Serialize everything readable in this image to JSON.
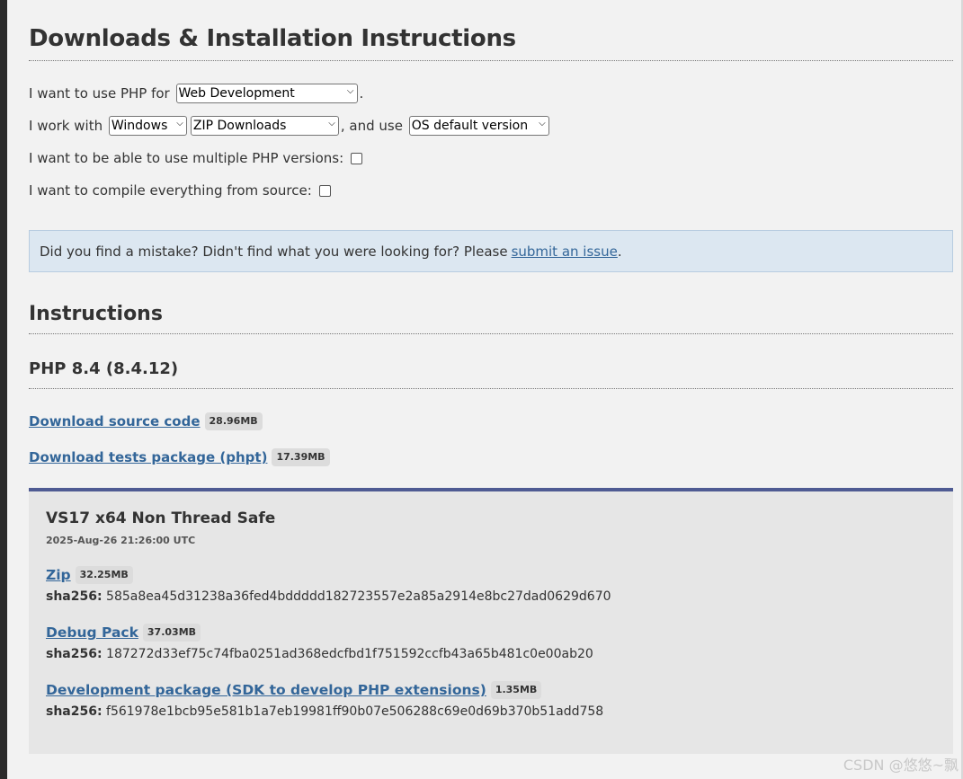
{
  "page": {
    "title": "Downloads & Installation Instructions",
    "watermark": "CSDN @悠悠~飘"
  },
  "form": {
    "line1_prefix": "I want to use PHP for",
    "usage_select": "Web Development",
    "line1_suffix": ".",
    "line2_prefix": "I work with",
    "os_select": "Windows",
    "package_select": "ZIP Downloads",
    "line2_mid": ", and use",
    "version_select": "OS default version",
    "multiple_label": "I want to be able to use multiple PHP versions:",
    "compile_label": "I want to compile everything from source:"
  },
  "notice": {
    "text": "Did you find a mistake? Didn't find what you were looking for? Please",
    "link": "submit an issue",
    "suffix": "."
  },
  "instructions": {
    "heading": "Instructions",
    "version_heading": "PHP 8.4 (8.4.12)",
    "source_link": "Download source code",
    "source_size": "28.96MB",
    "tests_link": "Download tests package (phpt)",
    "tests_size": "17.39MB"
  },
  "build": {
    "title": "VS17 x64 Non Thread Safe",
    "date": "2025-Aug-26 21:26:00 UTC",
    "sha_label": "sha256:",
    "files": [
      {
        "name": "Zip",
        "size": "32.25MB",
        "sha": "585a8ea45d31238a36fed4bddddd182723557e2a85a2914e8bc27dad0629d670"
      },
      {
        "name": "Debug Pack",
        "size": "37.03MB",
        "sha": "187272d33ef75c74fba0251ad368edcfbd1f751592ccfb43a65b481c0e00ab20"
      },
      {
        "name": "Development package (SDK to develop PHP extensions)",
        "size": "1.35MB",
        "sha": "f561978e1bcb95e581b1a7eb19981ff90b07e506288c69e0d69b370b51add758"
      }
    ]
  }
}
